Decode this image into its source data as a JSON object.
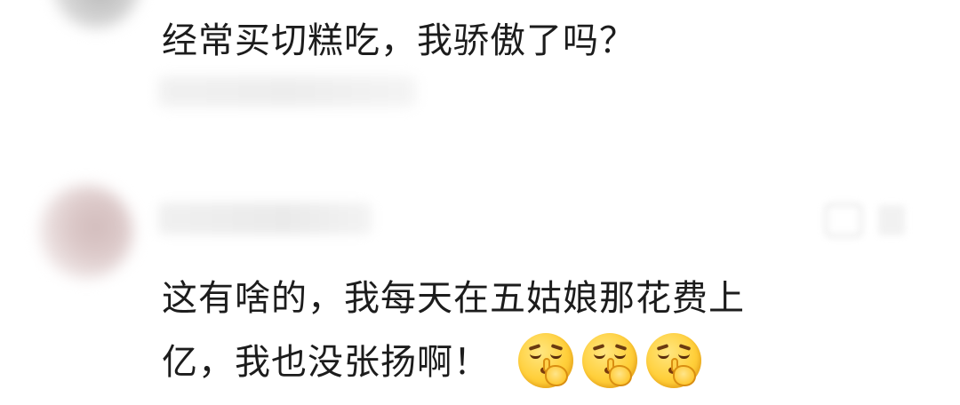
{
  "comments": [
    {
      "text": "经常买切糕吃，我骄傲了吗？"
    },
    {
      "text_line1": "这有啥的，我每天在五姑娘那花费上",
      "text_line2": "亿，我也没张扬啊！",
      "emojis": [
        "shushing-face-emoji",
        "shushing-face-emoji",
        "shushing-face-emoji"
      ]
    }
  ]
}
